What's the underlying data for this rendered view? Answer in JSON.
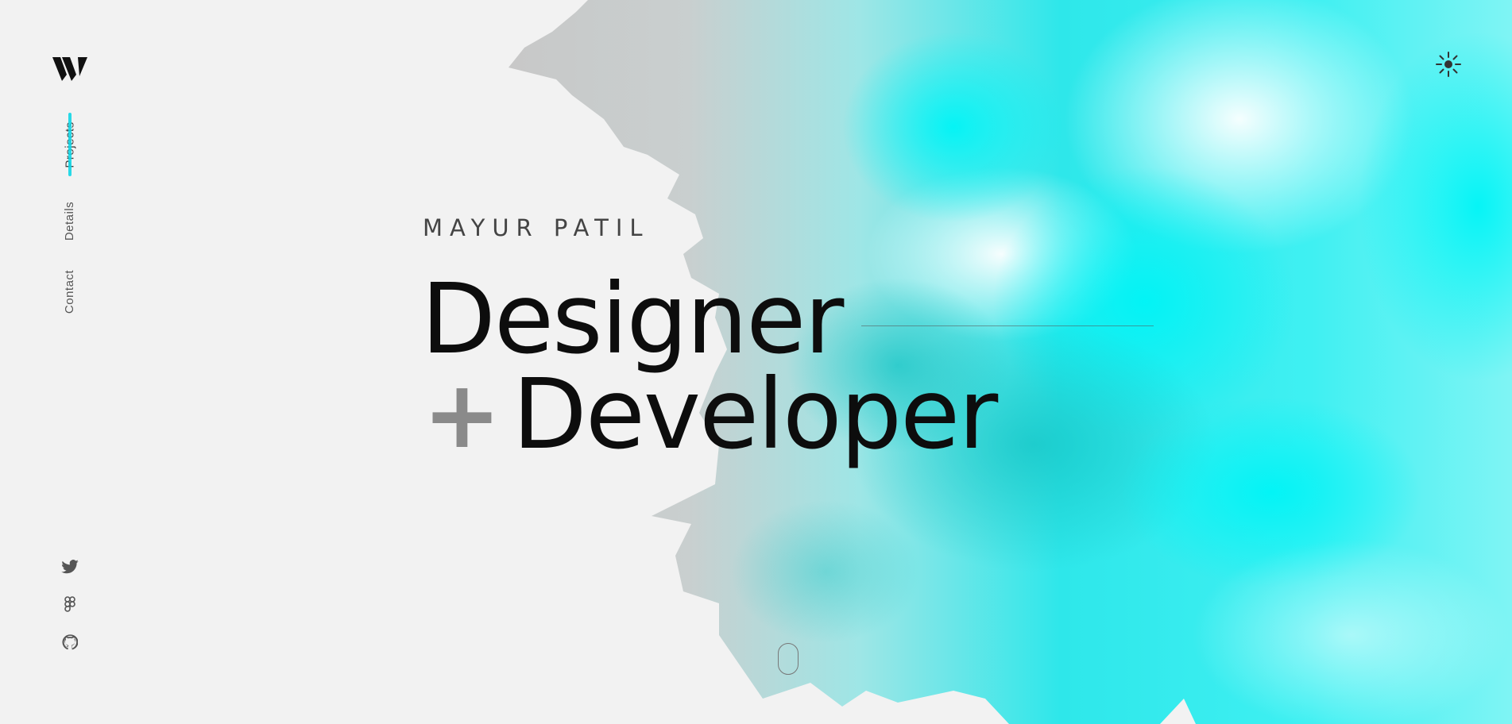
{
  "site": {
    "brand": "W",
    "accent_color": "#12d6e6"
  },
  "nav": {
    "items": [
      {
        "label": "Projects",
        "active": true
      },
      {
        "label": "Details",
        "active": false
      },
      {
        "label": "Contact",
        "active": false
      }
    ]
  },
  "social": {
    "icons": [
      "twitter-icon",
      "figma-icon",
      "github-icon"
    ]
  },
  "theme_toggle": {
    "icon": "sun-icon"
  },
  "hero": {
    "name": "MAYUR PATIL",
    "headline_line1": "Designer",
    "headline_plus": "+",
    "headline_line2": "Developer"
  },
  "scroll": {
    "icon": "scroll-mouse-icon"
  }
}
